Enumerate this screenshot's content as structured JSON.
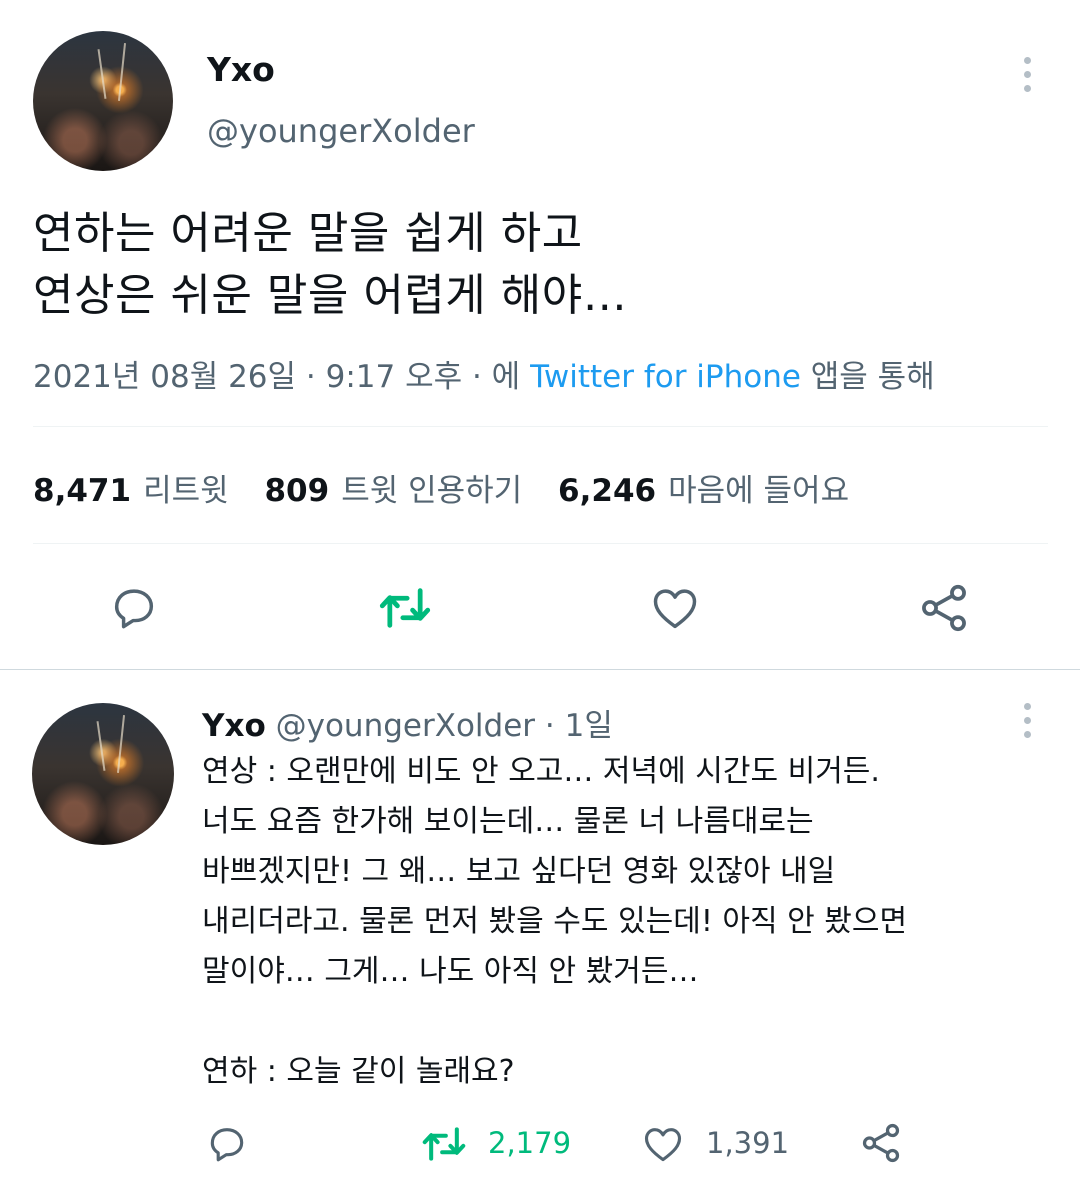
{
  "tweet": {
    "author_name": "Yxo",
    "author_handle": "@youngerXolder",
    "text_line1": "연하는 어려운 말을 쉽게 하고",
    "text_line2": "연상은 쉬운 말을 어렵게 해야…",
    "meta_date": "2021년 08월 26일 · 9:17 오후 · 에 ",
    "meta_source": "Twitter for iPhone",
    "meta_suffix": " 앱을 통해",
    "retweets_count": "8,471",
    "retweets_label": "리트윗",
    "quotes_count": "809",
    "quotes_label": "트윗 인용하기",
    "likes_count": "6,246",
    "likes_label": "마음에 들어요"
  },
  "reply": {
    "author_name": "Yxo",
    "author_handle": "@youngerXolder",
    "time": "· 1일",
    "lines": [
      "연상 : 오랜만에 비도 안 오고… 저녁에 시간도 비거든.",
      "너도 요즘 한가해 보이는데… 물론 너 나름대로는",
      "바쁘겠지만! 그 왜… 보고 싶다던 영화 있잖아 내일",
      "내리더라고. 물론 먼저 봤을 수도 있는데! 아직 안 봤으면",
      "말이야… 그게… 나도 아직 안 봤거든…",
      "",
      "연하 : 오늘 같이 놀래요?"
    ],
    "retweet_count": "2,179",
    "like_count": "1,391"
  },
  "colors": {
    "accent": "#1d9bf0",
    "retweet_green": "#00ba7c",
    "secondary_text": "#536471"
  },
  "icons": [
    "more-icon",
    "reply-icon",
    "retweet-icon",
    "like-icon",
    "share-icon"
  ]
}
